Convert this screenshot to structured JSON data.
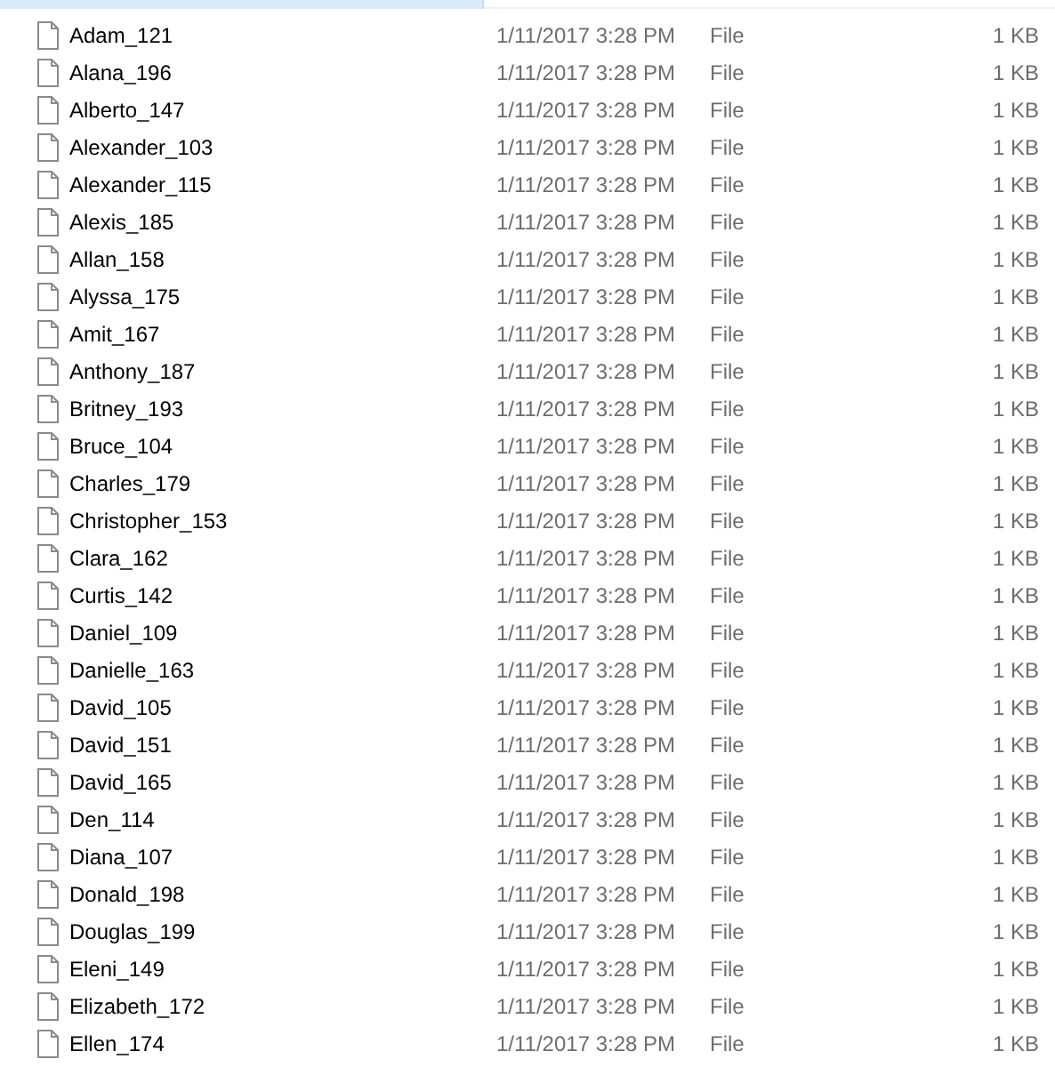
{
  "files": [
    {
      "name": "Adam_121",
      "modified": "1/11/2017 3:28 PM",
      "type": "File",
      "size": "1 KB"
    },
    {
      "name": "Alana_196",
      "modified": "1/11/2017 3:28 PM",
      "type": "File",
      "size": "1 KB"
    },
    {
      "name": "Alberto_147",
      "modified": "1/11/2017 3:28 PM",
      "type": "File",
      "size": "1 KB"
    },
    {
      "name": "Alexander_103",
      "modified": "1/11/2017 3:28 PM",
      "type": "File",
      "size": "1 KB"
    },
    {
      "name": "Alexander_115",
      "modified": "1/11/2017 3:28 PM",
      "type": "File",
      "size": "1 KB"
    },
    {
      "name": "Alexis_185",
      "modified": "1/11/2017 3:28 PM",
      "type": "File",
      "size": "1 KB"
    },
    {
      "name": "Allan_158",
      "modified": "1/11/2017 3:28 PM",
      "type": "File",
      "size": "1 KB"
    },
    {
      "name": "Alyssa_175",
      "modified": "1/11/2017 3:28 PM",
      "type": "File",
      "size": "1 KB"
    },
    {
      "name": "Amit_167",
      "modified": "1/11/2017 3:28 PM",
      "type": "File",
      "size": "1 KB"
    },
    {
      "name": "Anthony_187",
      "modified": "1/11/2017 3:28 PM",
      "type": "File",
      "size": "1 KB"
    },
    {
      "name": "Britney_193",
      "modified": "1/11/2017 3:28 PM",
      "type": "File",
      "size": "1 KB"
    },
    {
      "name": "Bruce_104",
      "modified": "1/11/2017 3:28 PM",
      "type": "File",
      "size": "1 KB"
    },
    {
      "name": "Charles_179",
      "modified": "1/11/2017 3:28 PM",
      "type": "File",
      "size": "1 KB"
    },
    {
      "name": "Christopher_153",
      "modified": "1/11/2017 3:28 PM",
      "type": "File",
      "size": "1 KB"
    },
    {
      "name": "Clara_162",
      "modified": "1/11/2017 3:28 PM",
      "type": "File",
      "size": "1 KB"
    },
    {
      "name": "Curtis_142",
      "modified": "1/11/2017 3:28 PM",
      "type": "File",
      "size": "1 KB"
    },
    {
      "name": "Daniel_109",
      "modified": "1/11/2017 3:28 PM",
      "type": "File",
      "size": "1 KB"
    },
    {
      "name": "Danielle_163",
      "modified": "1/11/2017 3:28 PM",
      "type": "File",
      "size": "1 KB"
    },
    {
      "name": "David_105",
      "modified": "1/11/2017 3:28 PM",
      "type": "File",
      "size": "1 KB"
    },
    {
      "name": "David_151",
      "modified": "1/11/2017 3:28 PM",
      "type": "File",
      "size": "1 KB"
    },
    {
      "name": "David_165",
      "modified": "1/11/2017 3:28 PM",
      "type": "File",
      "size": "1 KB"
    },
    {
      "name": "Den_114",
      "modified": "1/11/2017 3:28 PM",
      "type": "File",
      "size": "1 KB"
    },
    {
      "name": "Diana_107",
      "modified": "1/11/2017 3:28 PM",
      "type": "File",
      "size": "1 KB"
    },
    {
      "name": "Donald_198",
      "modified": "1/11/2017 3:28 PM",
      "type": "File",
      "size": "1 KB"
    },
    {
      "name": "Douglas_199",
      "modified": "1/11/2017 3:28 PM",
      "type": "File",
      "size": "1 KB"
    },
    {
      "name": "Eleni_149",
      "modified": "1/11/2017 3:28 PM",
      "type": "File",
      "size": "1 KB"
    },
    {
      "name": "Elizabeth_172",
      "modified": "1/11/2017 3:28 PM",
      "type": "File",
      "size": "1 KB"
    },
    {
      "name": "Ellen_174",
      "modified": "1/11/2017 3:28 PM",
      "type": "File",
      "size": "1 KB"
    }
  ]
}
